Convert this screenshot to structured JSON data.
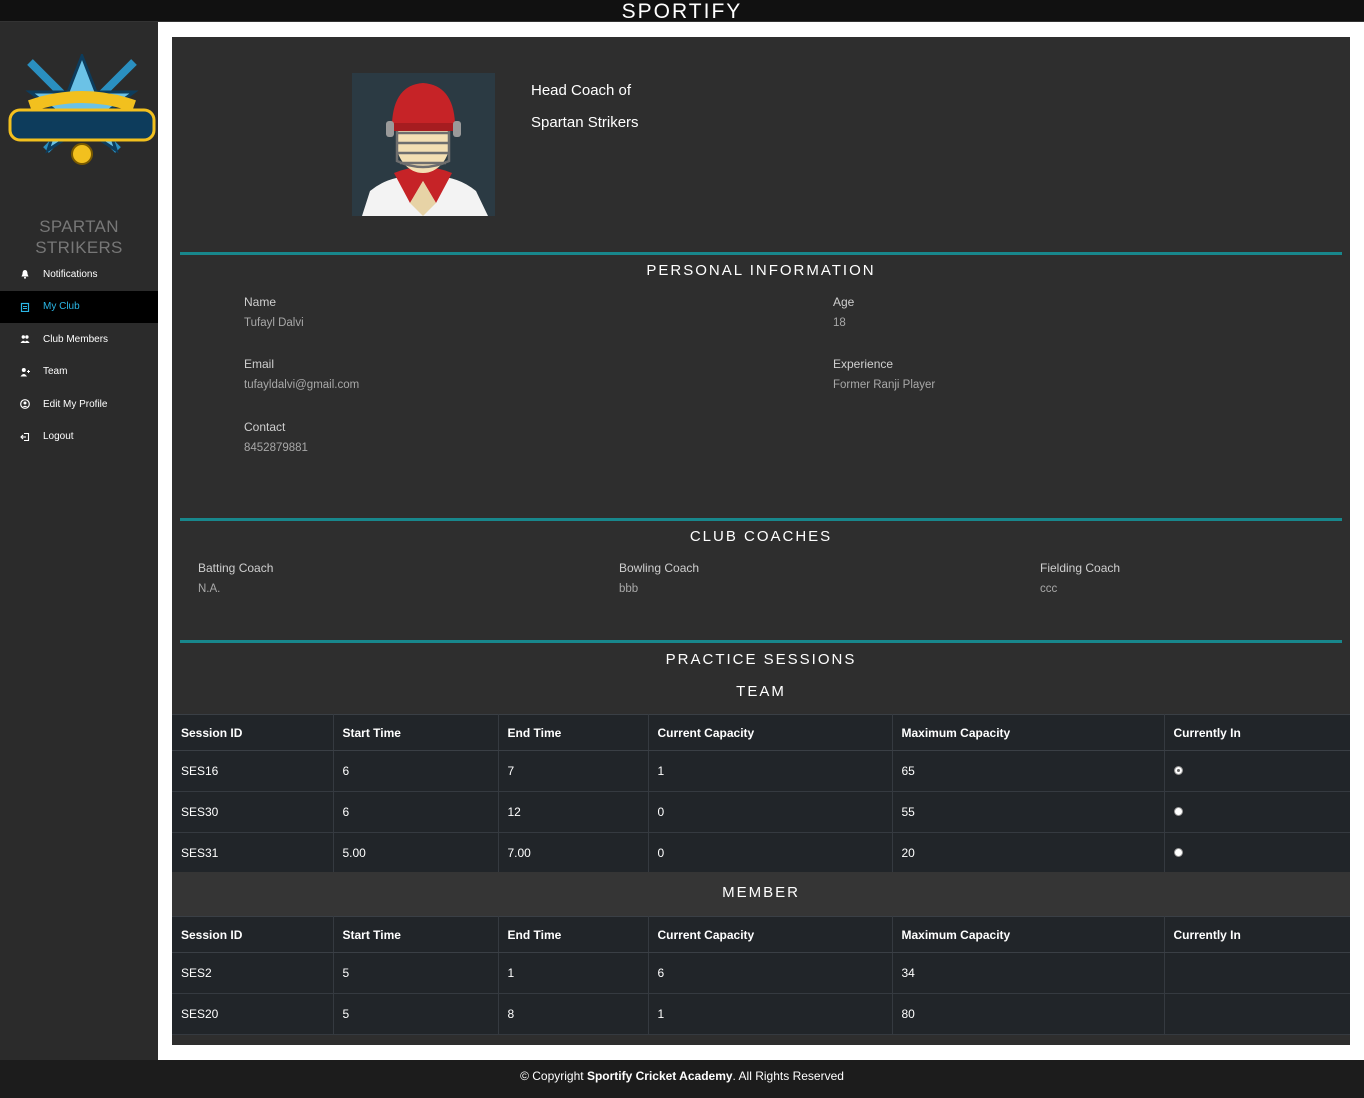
{
  "app": {
    "title": "SPORTIFY"
  },
  "sidebar": {
    "club_name": "SPARTAN STRIKERS",
    "logo_icon": "spartan-strikers-logo",
    "items": [
      {
        "label": "Notifications",
        "icon": "bell-icon",
        "active": false
      },
      {
        "label": "My Club",
        "icon": "clipboard-icon",
        "active": true
      },
      {
        "label": "Club Members",
        "icon": "users-icon",
        "active": false
      },
      {
        "label": "Team",
        "icon": "user-plus-icon",
        "active": false
      },
      {
        "label": "Edit My Profile",
        "icon": "user-circle-icon",
        "active": false
      },
      {
        "label": "Logout",
        "icon": "logout-icon",
        "active": false
      }
    ]
  },
  "profile": {
    "role_line1": "Head Coach of",
    "role_line2": "Spartan Strikers"
  },
  "personal": {
    "title": "PERSONAL INFORMATION",
    "name_label": "Name",
    "name_value": "Tufayl Dalvi",
    "age_label": "Age",
    "age_value": "18",
    "email_label": "Email",
    "email_value": "tufayldalvi@gmail.com",
    "experience_label": "Experience",
    "experience_value": "Former Ranji Player",
    "contact_label": "Contact",
    "contact_value": "8452879881"
  },
  "coaches": {
    "title": "CLUB COACHES",
    "batting_label": "Batting Coach",
    "batting_value": "N.A.",
    "bowling_label": "Bowling Coach",
    "bowling_value": "bbb",
    "fielding_label": "Fielding Coach",
    "fielding_value": "ccc"
  },
  "practice": {
    "title": "PRACTICE SESSIONS",
    "team_title": "TEAM",
    "member_title": "MEMBER",
    "columns": [
      "Session ID",
      "Start Time",
      "End Time",
      "Current Capacity",
      "Maximum Capacity",
      "Currently In"
    ],
    "team_rows": [
      {
        "id": "SES16",
        "start": "6",
        "end": "7",
        "current": "1",
        "max": "65",
        "in": true
      },
      {
        "id": "SES30",
        "start": "6",
        "end": "12",
        "current": "0",
        "max": "55",
        "in": false
      },
      {
        "id": "SES31",
        "start": "5.00",
        "end": "7.00",
        "current": "0",
        "max": "20",
        "in": false
      }
    ],
    "member_rows": [
      {
        "id": "SES2",
        "start": "5",
        "end": "1",
        "current": "6",
        "max": "34"
      },
      {
        "id": "SES20",
        "start": "5",
        "end": "8",
        "current": "1",
        "max": "80"
      }
    ]
  },
  "footer": {
    "prefix": "© Copyright ",
    "brand": "Sportify Cricket Academy",
    "suffix": ". All Rights Reserved"
  },
  "colors": {
    "accent": "#18878c",
    "active_link": "#2bb7e6"
  }
}
